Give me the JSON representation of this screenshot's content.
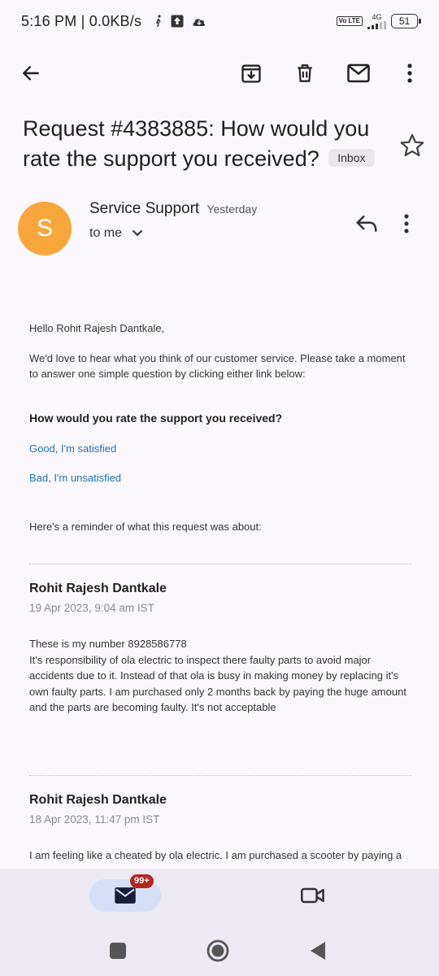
{
  "status_bar": {
    "time": "5:16 PM | 0.0KB/s",
    "volte": "Vo LTE",
    "network": "4G",
    "battery": "51"
  },
  "toolbar": {
    "back_icon": "arrow-left-icon",
    "archive_icon": "archive-icon",
    "delete_icon": "trash-icon",
    "unread_icon": "mail-icon",
    "more_icon": "more-vert-icon"
  },
  "email": {
    "subject": "Request #4383885: How would you rate the support you received?",
    "label": "Inbox",
    "sender_initial": "S",
    "sender_name": "Service Support",
    "sender_time": "Yesterday",
    "recipient": "to me",
    "body": {
      "greeting": "Hello Rohit Rajesh Dantkale,",
      "intro": "We'd love to hear what you think of our customer service. Please take a moment to answer one simple question by clicking either link below:",
      "question": "How would you rate the support you received?",
      "good_link": "Good, I'm satisfied",
      "bad_link": "Bad, I'm unsatisfied",
      "reminder": "Here's a reminder of what this request was about:"
    },
    "messages": [
      {
        "author": "Rohit Rajesh Dantkale",
        "date": "19 Apr 2023, 9:04 am IST",
        "text": "These is my number 8928586778\nIt's responsibility of ola electric to inspect there faulty parts to avoid major accidents due to it. Instead of that ola is busy in making money by replacing it's own faulty parts. I am purchased only 2 months back by paying the huge amount and the parts are becoming faulty. It's not acceptable"
      },
      {
        "author": "Rohit Rajesh Dantkale",
        "date": "18 Apr 2023, 11:47 pm IST",
        "text": "I am feeling like a cheated by ola electric. I am purchased a scooter by paying a"
      }
    ]
  },
  "bottom_nav": {
    "mail_badge": "99+",
    "mail_icon": "mail-icon",
    "meet_icon": "video-icon"
  },
  "colors": {
    "avatar": "#f7a63c",
    "link": "#1f73b7",
    "badge": "#b3261e",
    "active_tab": "#d5e0f8"
  }
}
